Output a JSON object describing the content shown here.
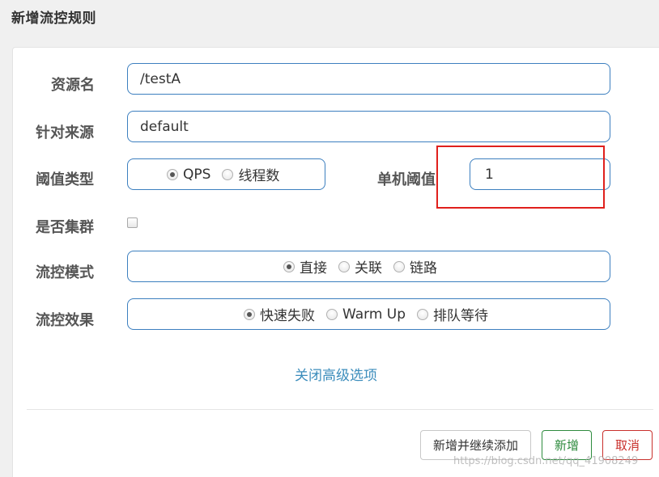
{
  "dialog": {
    "title": "新增流控规则"
  },
  "form": {
    "resource_name": {
      "label": "资源名",
      "value": "/testA"
    },
    "limit_app": {
      "label": "针对来源",
      "value": "default"
    },
    "grade": {
      "label": "阈值类型",
      "options": [
        "QPS",
        "线程数"
      ],
      "selected": "QPS"
    },
    "threshold": {
      "label": "单机阈值",
      "value": "1"
    },
    "cluster": {
      "label": "是否集群",
      "checked": false
    },
    "strategy": {
      "label": "流控模式",
      "options": [
        "直接",
        "关联",
        "链路"
      ],
      "selected": "直接"
    },
    "control_behavior": {
      "label": "流控效果",
      "options": [
        "快速失败",
        "Warm Up",
        "排队等待"
      ],
      "selected": "快速失败"
    },
    "advanced_link": "关闭高级选项"
  },
  "footer": {
    "add_continue_label": "新增并继续添加",
    "add_label": "新增",
    "cancel_label": "取消"
  },
  "annotation": {
    "highlight_color": "#e0201c"
  },
  "watermark": "https://blog.csdn.net/qq_41908249",
  "colors": {
    "input_border": "#3c7fbf",
    "link": "#3c8dbc",
    "success": "#2e8b3e",
    "danger": "#c9302c"
  }
}
